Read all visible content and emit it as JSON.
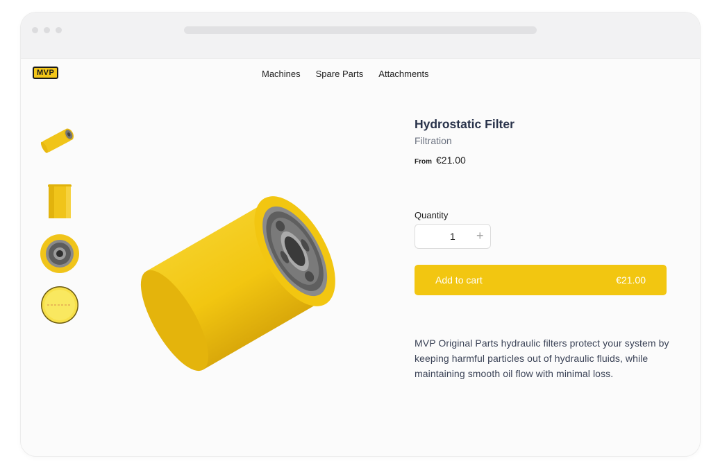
{
  "header": {
    "logo_text": "MVP",
    "nav": [
      {
        "label": "Machines"
      },
      {
        "label": "Spare Parts"
      },
      {
        "label": "Attachments"
      }
    ]
  },
  "product": {
    "title": "Hydrostatic Filter",
    "category": "Filtration",
    "price_prefix": "From",
    "price": "€21.00",
    "quantity_label": "Quantity",
    "quantity_value": "1",
    "quantity_increment_symbol": "+",
    "add_to_cart_label": "Add to cart",
    "add_to_cart_amount": "€21.00",
    "description": "MVP Original Parts hydraulic filters protect your system by keeping harmful particles out of hydraulic fluids, while maintaining smooth oil flow with minimal loss."
  },
  "colors": {
    "accent": "#f2c611",
    "title_text": "#28324a",
    "muted_text": "#6b7280"
  }
}
